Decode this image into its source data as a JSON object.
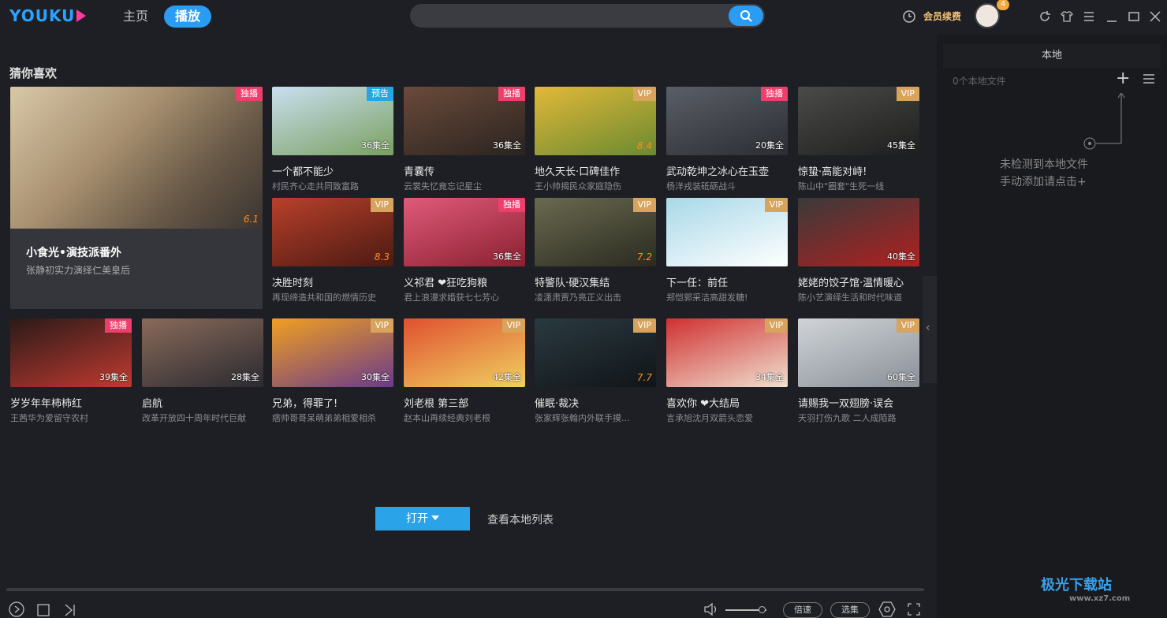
{
  "app": {
    "logo": "YOUKU"
  },
  "nav": {
    "home": "主页",
    "play": "播放"
  },
  "search": {
    "placeholder": ""
  },
  "topright": {
    "vip_label": "会员续费",
    "badge_count": "4"
  },
  "sidebar": {
    "tab": "本地",
    "count": "0个本地文件",
    "hint_line1": "未检测到本地文件",
    "hint_line2": "手动添加请点击+"
  },
  "section_title": "猜你喜欢",
  "feature": {
    "title": "小食光•演技派番外",
    "subtitle": "张静初实力演绎仁美皇后",
    "score": "6.1"
  },
  "cards": [
    {
      "title": "一个都不能少",
      "sub": "村民齐心走共同致富路",
      "badge": "预告",
      "badge_type": "pre",
      "ep": "36集全",
      "colors": [
        "#c9dff0",
        "#7aa060"
      ]
    },
    {
      "title": "青囊传",
      "sub": "云裳失忆竟忘记星尘",
      "badge": "独播",
      "badge_type": "excl",
      "ep": "36集全",
      "colors": [
        "#6b4a3a",
        "#2a2420"
      ]
    },
    {
      "title": "地久天长·口碑佳作",
      "sub": "王小帅揭民众家庭隐伤",
      "badge": "VIP",
      "badge_type": "vip",
      "ep": "",
      "score": "8.4",
      "colors": [
        "#e2b83a",
        "#6a8a30"
      ]
    },
    {
      "title": "武动乾坤之冰心在玉壶",
      "sub": "杨洋戎装砥砺战斗",
      "badge": "独播",
      "badge_type": "excl",
      "ep": "20集全",
      "colors": [
        "#5a5e66",
        "#2b2d33"
      ]
    },
    {
      "title": "惊蛰·高能对峙!",
      "sub": "陈山中\"圈套\"生死一线",
      "badge": "VIP",
      "badge_type": "vip",
      "ep": "45集全",
      "colors": [
        "#4a4a48",
        "#1e1e1e"
      ]
    },
    {
      "title": "决胜时刻",
      "sub": "再现缔造共和国的燃情历史",
      "badge": "VIP",
      "badge_type": "vip",
      "ep": "",
      "score": "8.3",
      "colors": [
        "#b8402a",
        "#4a1a12"
      ]
    },
    {
      "title": "义祁君 ❤狂吃狗粮",
      "sub": "君上浪漫求婚获七七芳心",
      "badge": "独播",
      "badge_type": "excl",
      "ep": "36集全",
      "colors": [
        "#e05a7a",
        "#8a2030"
      ]
    },
    {
      "title": "特警队·硬汉集结",
      "sub": "凌潇肃贾乃亮正义出击",
      "badge": "VIP",
      "badge_type": "vip",
      "ep": "",
      "score": "7.2",
      "colors": [
        "#6a6a50",
        "#2a2a20"
      ]
    },
    {
      "title": "下一任：前任",
      "sub": "郑恺郭采洁高甜发糖!",
      "badge": "VIP",
      "badge_type": "vip",
      "ep": "",
      "colors": [
        "#a8d8e8",
        "#ffffff"
      ]
    },
    {
      "title": "姥姥的饺子馆·温情暖心",
      "sub": "陈小艺演绎生活和时代味道",
      "badge": "",
      "badge_type": "",
      "ep": "40集全",
      "colors": [
        "#3a3a3a",
        "#b02020"
      ]
    },
    {
      "title": "岁岁年年柿柿红",
      "sub": "王茜华为爱留守农村",
      "badge": "独播",
      "badge_type": "excl",
      "ep": "39集全",
      "colors": [
        "#2a1a18",
        "#c03a30"
      ]
    },
    {
      "title": "启航",
      "sub": "改革开放四十周年时代巨献",
      "badge": "",
      "badge_type": "",
      "ep": "28集全",
      "colors": [
        "#8a6a5a",
        "#2a2a30"
      ]
    },
    {
      "title": "兄弟，得罪了!",
      "sub": "痞帅哥哥呆萌弟弟相爱相杀",
      "badge": "VIP",
      "badge_type": "vip",
      "ep": "30集全",
      "colors": [
        "#f0a020",
        "#6a3a8a"
      ]
    },
    {
      "title": "刘老根 第三部",
      "sub": "赵本山再续经典刘老根",
      "badge": "VIP",
      "badge_type": "vip",
      "ep": "42集全",
      "colors": [
        "#e05030",
        "#f0d060"
      ]
    },
    {
      "title": "催眠·裁决",
      "sub": "张家辉张翰内外联手摸...",
      "badge": "VIP",
      "badge_type": "vip",
      "ep": "",
      "score": "7.7",
      "colors": [
        "#2a3a40",
        "#101418"
      ]
    },
    {
      "title": "喜欢你 ❤大结局",
      "sub": "言承旭沈月双箭头恋爱",
      "badge": "VIP",
      "badge_type": "vip",
      "ep": "34集全",
      "colors": [
        "#d03030",
        "#f0e0d0"
      ]
    },
    {
      "title": "请赐我一双翅膀·误会",
      "sub": "天羽打伤九歌 二人成陌路",
      "badge": "VIP",
      "badge_type": "vip",
      "ep": "60集全",
      "colors": [
        "#d0d4d8",
        "#8a9098"
      ]
    }
  ],
  "actions": {
    "open": "打开",
    "local_list": "查看本地列表"
  },
  "player": {
    "speed": "倍速",
    "episodes": "选集"
  },
  "watermark": {
    "main": "极光下载站",
    "sub": "www.xz7.com"
  }
}
